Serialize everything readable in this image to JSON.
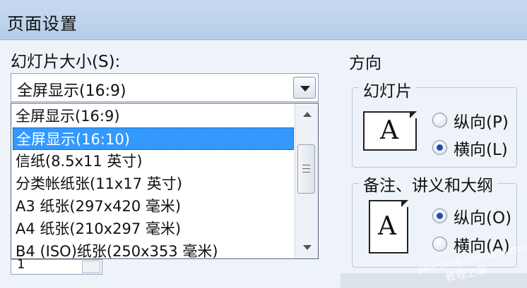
{
  "dialog": {
    "title": "页面设置"
  },
  "slide_size": {
    "label": "幻灯片大小(S):",
    "selected": "全屏显示(16:9)",
    "options": [
      "全屏显示(16:9)",
      "全屏显示(16:10)",
      "信纸(8.5x11 英寸)",
      "分类帐纸张(11x17 英寸)",
      "A3 纸张(297x420 毫米)",
      "A4 纸张(210x297 毫米)",
      "B4 (ISO)纸张(250x353 毫米)"
    ],
    "highlighted_index": 1,
    "hidden_field_value": "1"
  },
  "orientation": {
    "label": "方向",
    "slides": {
      "label": "幻灯片",
      "icon_letter": "A",
      "portrait": {
        "label": "纵向(P)",
        "checked": false
      },
      "landscape": {
        "label": "横向(L)",
        "checked": true
      }
    },
    "notes": {
      "label": "备注、讲义和大纲",
      "icon_letter": "A",
      "portrait": {
        "label": "纵向(O)",
        "checked": true
      },
      "landscape": {
        "label": "横向(A)",
        "checked": false
      }
    }
  },
  "watermark": {
    "text": "jiaocheng.chazidian.com",
    "text_cn": "教程之家"
  }
}
